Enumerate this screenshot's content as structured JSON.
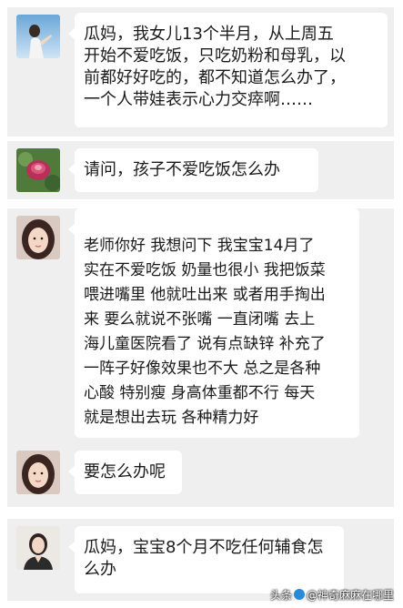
{
  "messages": [
    {
      "avatar": "girl-sky-avatar",
      "lines": [
        "瓜妈，我女儿13个半月，从上周五",
        "开始不爱吃饭，只吃奶粉和母乳，以",
        "前都好好吃的，都不知道怎么办了，",
        "一个人带娃表示心力交瘁啊……"
      ]
    },
    {
      "avatar": "flower-avatar",
      "lines": [
        "请问，孩子不爱吃饭怎么办"
      ]
    },
    {
      "avatar": "woman-photo-avatar",
      "lines": [
        "老师你好 我想问下 我宝宝14月了",
        "实在不爱吃饭 奶量也很小 我把饭菜",
        "喂进嘴里 他就吐出来 或者用手掏出",
        "来 要么就说不张嘴 一直闭嘴 去上",
        "海儿童医院看了 说有点缺锌 补充了",
        "一阵子好像效果也不大 总之是各种",
        "心酸 特别瘦 身高体重都不行 每天",
        "就是想出去玩 各种精力好"
      ]
    },
    {
      "avatar": "woman-photo-avatar",
      "lines": [
        "要怎么办呢"
      ]
    },
    {
      "avatar": "woman-portrait-avatar",
      "lines": [
        "瓜妈，宝宝8个月不吃任何辅食怎",
        "么办"
      ]
    }
  ],
  "watermark": {
    "prefix": "头条",
    "handle": "@神奇麻麻在哪里"
  },
  "colors": {
    "panel_bg": "#efeff0",
    "bubble_bg": "#ffffff",
    "text": "#1a1a1a"
  }
}
